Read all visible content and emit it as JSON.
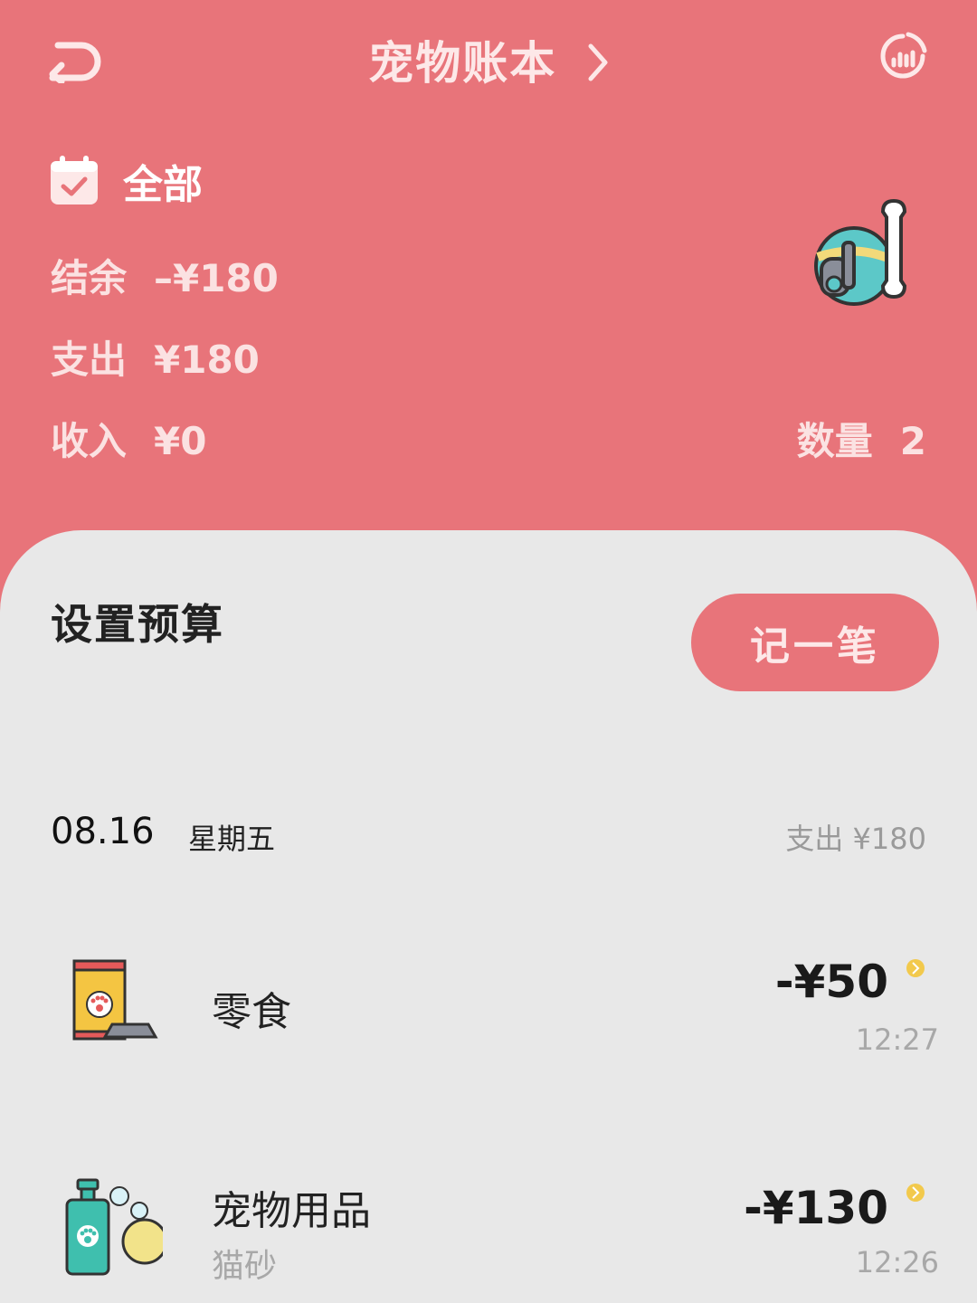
{
  "header": {
    "title": "宠物账本",
    "back_icon": "back-arrow-icon",
    "stats_icon": "chart-icon",
    "chevron_icon": "chevron-right-icon"
  },
  "filter": {
    "label": "全部",
    "icon": "calendar-check-icon"
  },
  "summary": {
    "balance_label": "结余",
    "balance_value": "–¥180",
    "expense_label": "支出",
    "expense_value": "¥180",
    "income_label": "收入",
    "income_value": "¥0",
    "count_label": "数量",
    "count_value": "2"
  },
  "actions": {
    "budget_label": "设置预算",
    "record_label": "记一笔"
  },
  "day": {
    "date": "08.16",
    "weekday": "星期五",
    "total": "支出 ¥180"
  },
  "entries": [
    {
      "category": "零食",
      "note": "",
      "amount": "-¥50",
      "time": "12:27",
      "icon": "pet-food-bag-icon"
    },
    {
      "category": "宠物用品",
      "note": "猫砂",
      "amount": "-¥130",
      "time": "12:26",
      "icon": "pet-shampoo-icon"
    }
  ],
  "colors": {
    "accent": "#e8747a",
    "background": "#e8e8e8",
    "coin": "#f2c94c"
  }
}
